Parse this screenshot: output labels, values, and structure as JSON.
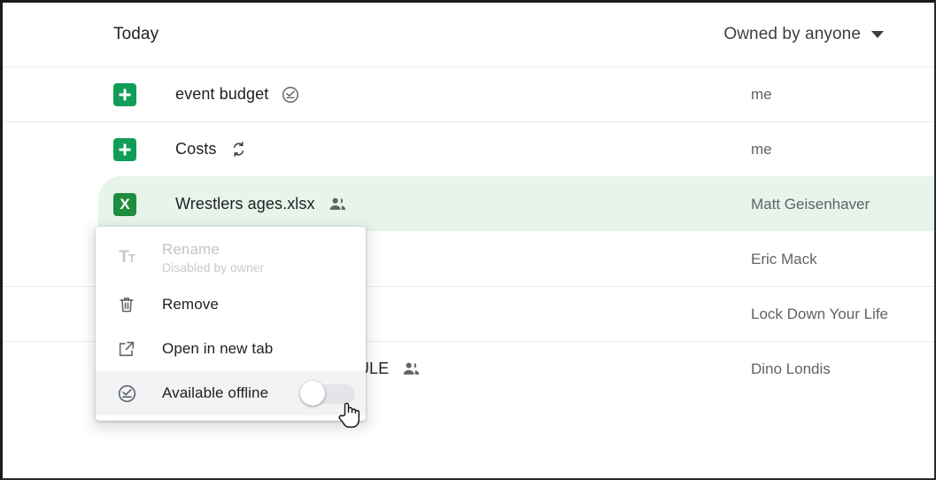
{
  "header": {
    "section_title": "Today",
    "owner_filter_label": "Owned by anyone",
    "caret_icon": "chevron-down-icon"
  },
  "colors": {
    "sheets_green": "#0f9d58",
    "xlsx_green": "#1e8e3e",
    "selected_row_bg": "#e6f4ea",
    "menu_hover_bg": "#f1f3f4",
    "icon_gray": "#5f6368",
    "text_primary": "#202124",
    "text_secondary": "#5f6368",
    "disabled_text": "#c2c5c9"
  },
  "rows": [
    {
      "name": "event budget",
      "icon": "google-sheets-icon",
      "icon_glyph": "✚",
      "badge": "available-offline-icon",
      "owner": "me",
      "selected": false
    },
    {
      "name": "Costs",
      "icon": "google-sheets-icon",
      "icon_glyph": "✚",
      "badge": "sync-icon",
      "owner": "me",
      "selected": false
    },
    {
      "name": "Wrestlers ages.xlsx",
      "icon": "excel-xlsx-icon",
      "icon_glyph": "X",
      "badge": "shared-people-icon",
      "owner": "Matt Geisenhaver",
      "selected": true
    },
    {
      "name": "",
      "icon": "google-sheets-icon",
      "icon_glyph": "✚",
      "badge": "",
      "owner": "Eric Mack",
      "selected": false
    },
    {
      "name": "",
      "icon": "google-sheets-icon",
      "icon_glyph": "✚",
      "badge": "",
      "owner": "Lock Down Your Life",
      "selected": false
    },
    {
      "name": "HTC EDITORIAL SCHEDULE",
      "icon": "google-sheets-icon",
      "icon_glyph": "✚",
      "badge": "shared-people-icon",
      "owner": "Dino Londis",
      "selected": false
    }
  ],
  "context_menu": {
    "items": [
      {
        "label": "Rename",
        "sublabel": "Disabled by owner",
        "icon": "text-format-icon",
        "disabled": true,
        "hovered": false,
        "toggle": null
      },
      {
        "label": "Remove",
        "sublabel": "",
        "icon": "trash-icon",
        "disabled": false,
        "hovered": false,
        "toggle": null
      },
      {
        "label": "Open in new tab",
        "sublabel": "",
        "icon": "open-in-new-icon",
        "disabled": false,
        "hovered": false,
        "toggle": null
      },
      {
        "label": "Available offline",
        "sublabel": "",
        "icon": "available-offline-icon",
        "disabled": false,
        "hovered": true,
        "toggle": "off"
      }
    ]
  },
  "cursor": {
    "icon": "pointer-hand-cursor"
  }
}
